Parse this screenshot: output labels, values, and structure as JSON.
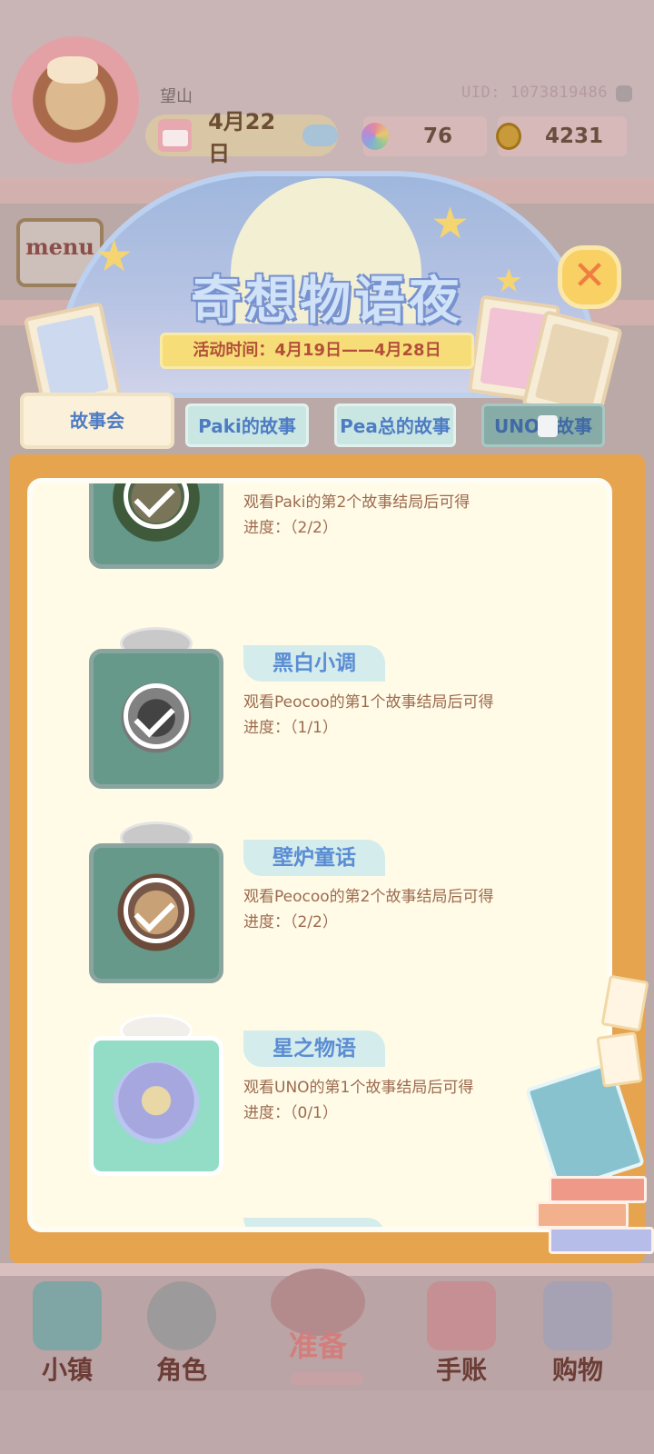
{
  "topbar": {
    "username": "望山",
    "uid": "UID: 1073819486",
    "date": "4月22日",
    "gems": "76",
    "coins": "4231"
  },
  "side_menu": {
    "label": "menu"
  },
  "event": {
    "title": "奇想物语夜",
    "time": "活动时间：4月19日——4月28日",
    "close_label": "✕"
  },
  "tabs": [
    {
      "label": "故事会",
      "state": "active"
    },
    {
      "label": "Paki的故事",
      "state": "normal"
    },
    {
      "label": "Pea总的故事",
      "state": "normal"
    },
    {
      "label_pre": "UNO",
      "label_post": "故事",
      "state": "locked"
    }
  ],
  "rewards": [
    {
      "name": "",
      "desc": "观看Paki的第2个故事结局后可得",
      "progress": "进度：（2/2）",
      "claimed": true
    },
    {
      "name": "黑白小调",
      "desc": "观看Peocoo的第1个故事结局后可得",
      "progress": "进度：（1/1）",
      "claimed": true
    },
    {
      "name": "壁炉童话",
      "desc": "观看Peocoo的第2个故事结局后可得",
      "progress": "进度：（2/2）",
      "claimed": true
    },
    {
      "name": "星之物语",
      "desc": "观看UNO的第1个故事结局后可得",
      "progress": "进度：（0/1）",
      "claimed": false
    }
  ],
  "bottom_nav": [
    {
      "label": "小镇",
      "icon": "map-icon"
    },
    {
      "label": "角色",
      "icon": "character-icon"
    },
    {
      "label": "准备",
      "icon": "prepare-icon",
      "active": true
    },
    {
      "label": "手账",
      "icon": "journal-icon"
    },
    {
      "label": "购物",
      "icon": "shopping-bag-icon"
    }
  ],
  "colors": {
    "frame": "#e6a44f",
    "panel": "#fffbe7",
    "title_fill": "#cfe2f7",
    "tab_text": "#4e7cc3",
    "desc_text": "#9c6a4f"
  }
}
